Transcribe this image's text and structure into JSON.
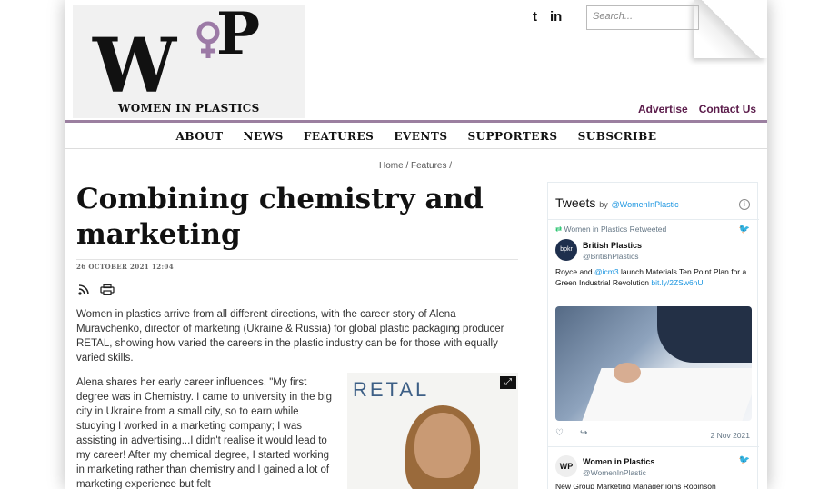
{
  "header": {
    "logo_mark_w": "W",
    "logo_mark_p": "P",
    "logo_tagline": "WOMEN IN PLASTICS",
    "social_icons": [
      "twitter-icon",
      "linkedin-icon"
    ],
    "social_glyphs": [
      "t",
      "in"
    ],
    "search_placeholder": "Search...",
    "links": [
      "Advertise",
      "Contact Us"
    ],
    "accent_color": "#5a1b4a"
  },
  "nav": [
    "ABOUT",
    "NEWS",
    "FEATURES",
    "EVENTS",
    "SUPPORTERS",
    "SUBSCRIBE"
  ],
  "breadcrumb": "Home / Features /",
  "article": {
    "title": "Combining chemistry and marketing",
    "date": "26 OCTOBER 2021  12:04",
    "icons": [
      "rss-icon",
      "print-icon"
    ],
    "paragraph1": "Women in plastics arrive from all different directions, with the career story of Alena Muravchenko, director of marketing (Ukraine & Russia) for global plastic packaging producer RETAL, showing how varied the careers in the plastic industry can be for those with equally varied skills.",
    "paragraph2": "Alena shares her early career influences. \"My first degree was in Chemistry. I came to university in the big city in Ukraine from a small city, so to earn while studying I worked in a marketing company; I was assisting in advertising...I didn't realise it would lead to my career! After my chemical degree, I started working in marketing rather than chemistry and I gained a lot of marketing experience but felt",
    "image_brand": "RETAL"
  },
  "tweets": {
    "title": "Tweets",
    "by": "by",
    "handle": "@WomenInPlastic",
    "info": "i",
    "retweet_label": "Women in Plastics Retweeted",
    "tweet1": {
      "avatar_text": "bpkr",
      "name": "British Plastics",
      "handle": "@BritishPlastics",
      "text_a": "Royce and ",
      "text_link1": "@icm3",
      "text_b": " launch Materials Ten Point Plan for a Green Industrial Revolution",
      "text_link2": "bit.ly/2ZSw6nU",
      "date": "2 Nov 2021"
    },
    "tweet2": {
      "avatar_text": "WP",
      "name": "Women in Plastics",
      "handle": "@WomenInPlastic",
      "text": "New Group Marketing Manager joins Robinson"
    }
  }
}
